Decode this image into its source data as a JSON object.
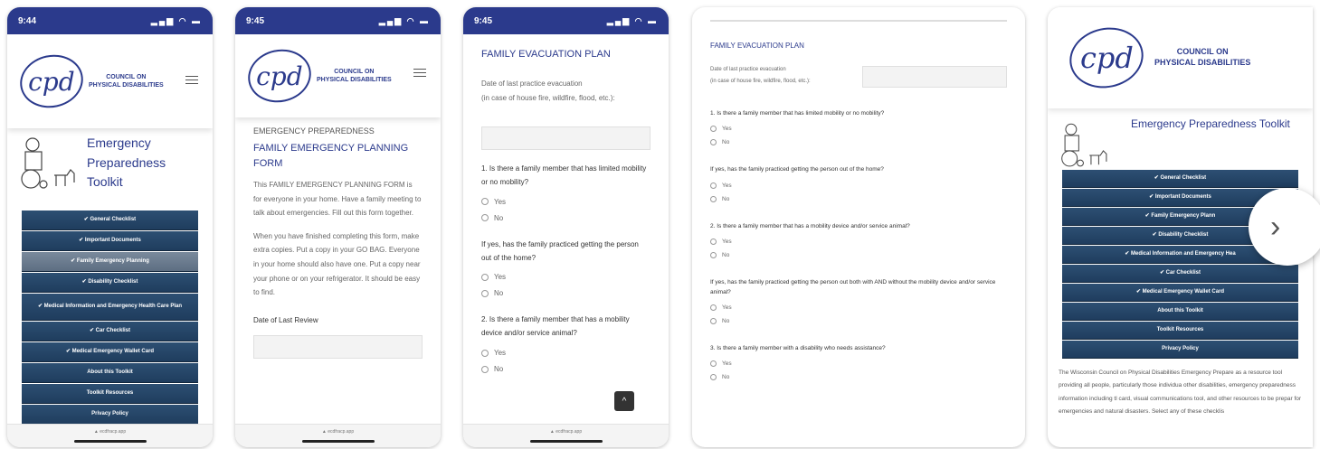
{
  "logo": {
    "mark": "cpd",
    "org_line1": "COUNCIL ON",
    "org_line2": "PHYSICAL DISABILITIES"
  },
  "screen1": {
    "time": "9:44",
    "title_lines": [
      "Emergency",
      "Preparedness",
      "Toolkit"
    ],
    "nav": [
      "✔ General Checklist",
      "✔ Important Documents",
      "✔ Family Emergency Planning",
      "✔ Disability Checklist",
      "✔ Medical Information and Emergency Health Care Plan",
      "✔ Car Checklist",
      "✔ Medical Emergency Wallet Card",
      "About this Toolkit",
      "Toolkit Resources",
      "Privacy Policy"
    ],
    "footer": "▲ ecdfracp.app"
  },
  "screen2": {
    "time": "9:45",
    "section": "EMERGENCY PREPAREDNESS",
    "form_title": "FAMILY EMERGENCY PLANNING FORM",
    "para1": "This FAMILY EMERGENCY PLANNING FORM is for everyone in your home. Have a family meeting to talk about emergencies. Fill out this form together.",
    "para2": "When you have finished completing this form, make extra copies. Put a copy in your GO BAG. Everyone in your home should also have one. Put a copy near your phone or on your refrigerator. It should be easy to find.",
    "review_label": "Date of Last Review",
    "footer": "▲ ecdfracp.app"
  },
  "screen3": {
    "time": "9:45",
    "heading": "FAMILY EVACUATION PLAN",
    "date_label_1": "Date of last practice evacuation",
    "date_label_2": "(in case of house fire, wildfire, flood, etc.):",
    "q1": "1. Is there a family member that has limited mobility or no mobility?",
    "q1b": "If yes, has the family practiced getting the person out of the home?",
    "q2": "2. Is there a family member that has a mobility device and/or service animal?",
    "yes": "Yes",
    "no": "No",
    "scroll_top": "^",
    "footer": "▲ ecdfracp.app"
  },
  "screen4": {
    "heading": "FAMILY EVACUATION PLAN",
    "date_label_1": "Date of last practice evacuation",
    "date_label_2": "(in case of house fire, wildfire, flood, etc.):",
    "questions": [
      "1. Is there a family member that has limited mobility or no mobility?",
      "If yes, has the family practiced getting the person out of the home?",
      "2. Is there a family member that has a mobility device and/or service animal?",
      "If yes, has the family practiced getting the person out both with AND without the mobility device and/or service animal?",
      "3. Is there a family member with a disability who needs assistance?"
    ],
    "yes": "Yes",
    "no": "No"
  },
  "screen5": {
    "title": "Emergency Preparedness Toolkit",
    "nav": [
      "✔ General Checklist",
      "✔ Important Documents",
      "✔ Family Emergency Plann",
      "✔ Disability Checklist",
      "✔ Medical Information and Emergency Hea",
      "✔ Car Checklist",
      "✔ Medical Emergency Wallet Card",
      "About this Toolkit",
      "Toolkit Resources",
      "Privacy Policy"
    ],
    "description": "The Wisconsin Council on Physical Disabilities Emergency Prepare as a resource tool providing all people, particularly those individua other disabilities, emergency preparedness information including tl card, visual communications tool, and other resources to be prepar for emergencies and natural disasters. Select any of these checklis"
  },
  "carousel": {
    "next_glyph": "›"
  },
  "colors": {
    "brand": "#2b3a8c",
    "nav_button": "#1f3d5e"
  }
}
